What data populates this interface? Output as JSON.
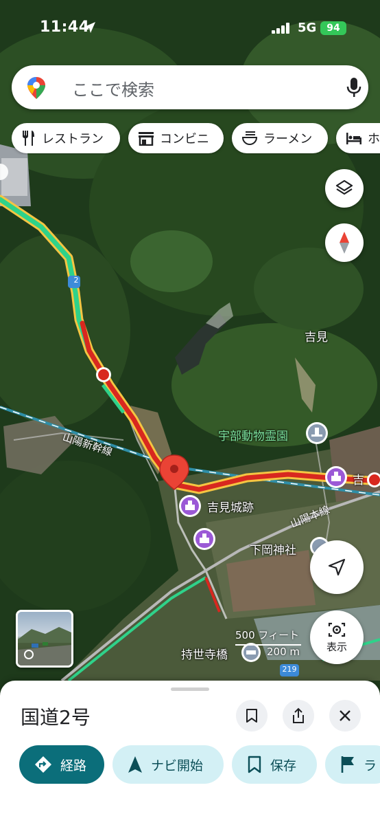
{
  "status_bar": {
    "time": "11:44",
    "network": "5G",
    "battery": "94"
  },
  "search": {
    "placeholder": "ここで検索"
  },
  "chips": [
    {
      "label": "レストラン",
      "icon": "fork-knife-icon"
    },
    {
      "label": "コンビニ",
      "icon": "store-icon"
    },
    {
      "label": "ラーメン",
      "icon": "ramen-bowl-icon"
    },
    {
      "label": "ホ",
      "icon": "bed-icon"
    }
  ],
  "map": {
    "route_badge": "2",
    "route_badge_219": "219",
    "labels": {
      "yoshimi": "吉見",
      "ube_cemetery": "宇部動物霊園",
      "yoshimi_castle": "吉見城跡",
      "shimooka_shrine": "下岡神社",
      "mochiyoji_bridge": "持世寺橋",
      "right_edge": "吉"
    },
    "rail_labels": {
      "shinkansen": "山陽新幹線",
      "honsen": "山陽本線"
    },
    "scale": {
      "feet": "500 フィート",
      "meters": "200 m"
    }
  },
  "controls": {
    "layers_icon": "layers-icon",
    "compass_icon": "compass-icon",
    "locate_icon": "navigation-arrow-icon",
    "view_label": "表示"
  },
  "sheet": {
    "title": "国道2号",
    "actions": [
      {
        "label": "経路",
        "icon": "directions-icon"
      },
      {
        "label": "ナビ開始",
        "icon": "navigation-icon"
      },
      {
        "label": "保存",
        "icon": "bookmark-icon"
      },
      {
        "label": "ラ",
        "icon": "flag-icon"
      }
    ]
  },
  "colors": {
    "traffic_green": "#2fd28a",
    "traffic_yellow": "#f5c542",
    "traffic_red": "#d8281f",
    "pin_red": "#ea4335",
    "poi_purple": "#9b59d6",
    "primary_teal": "#0b6e7a"
  }
}
